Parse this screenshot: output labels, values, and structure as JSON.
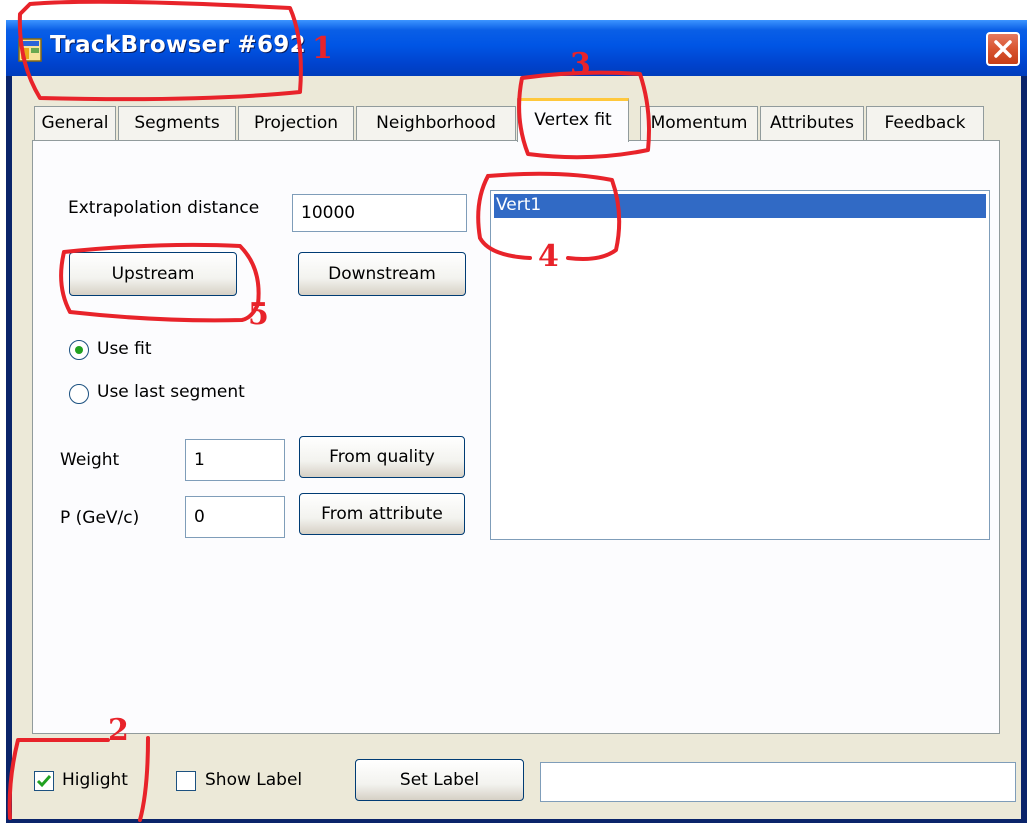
{
  "window": {
    "title": "TrackBrowser #692",
    "icon": "app-window-icon",
    "close_icon": "close-x-icon"
  },
  "tabs": [
    {
      "label": "General"
    },
    {
      "label": "Segments"
    },
    {
      "label": "Projection"
    },
    {
      "label": "Neighborhood"
    },
    {
      "label": "Vertex fit",
      "active": true
    },
    {
      "label": "Momentum"
    },
    {
      "label": "Attributes"
    },
    {
      "label": "Feedback"
    }
  ],
  "vertex_fit": {
    "extrapolation_label": "Extrapolation distance",
    "extrapolation_value": "10000",
    "upstream_label": "Upstream",
    "downstream_label": "Downstream",
    "use_fit_label": "Use fit",
    "use_fit_selected": true,
    "use_last_segment_label": "Use last segment",
    "weight_label": "Weight",
    "weight_value": "1",
    "from_quality_label": "From quality",
    "p_label": "P (GeV/c)",
    "p_value": "0",
    "from_attribute_label": "From attribute",
    "vertex_list": [
      "Vert1"
    ]
  },
  "footer": {
    "highlight_label": "Higlight",
    "highlight_checked": true,
    "show_label_label": "Show Label",
    "show_label_checked": false,
    "set_label_button": "Set Label",
    "label_value": ""
  },
  "annotations": [
    "1",
    "2",
    "3",
    "4",
    "5"
  ],
  "colors": {
    "annotation_red": "#e8232a",
    "titlebar_blue": "#0055e5",
    "selection_blue": "#316ac5",
    "tab_highlight": "#ffc83c"
  }
}
